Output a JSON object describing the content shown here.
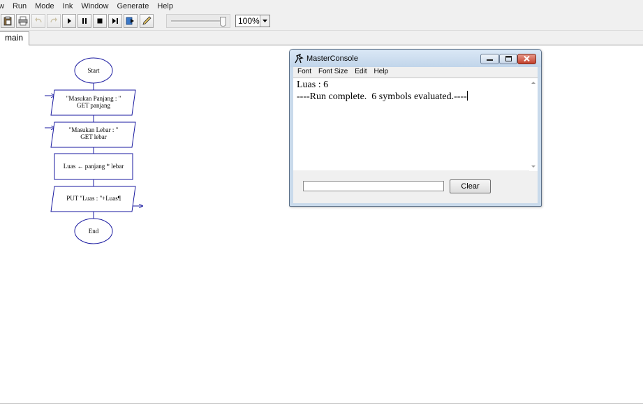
{
  "menubar": {
    "items": [
      {
        "label": "w"
      },
      {
        "label": "Run"
      },
      {
        "label": "Mode"
      },
      {
        "label": "Ink"
      },
      {
        "label": "Window"
      },
      {
        "label": "Generate"
      },
      {
        "label": "Help"
      }
    ]
  },
  "toolbar": {
    "zoom_value": "100%",
    "icons": [
      "paste-icon",
      "print-icon",
      "undo-icon",
      "redo-icon",
      "play-icon",
      "pause-icon",
      "stop-icon",
      "step-icon",
      "step-into-icon",
      "pen-icon"
    ]
  },
  "tabs": [
    {
      "label": "main"
    }
  ],
  "flowchart": {
    "start": "Start",
    "input1_line1": "\"Masukan Panjang : \"",
    "input1_line2": "GET panjang",
    "input2_line1": "\"Masukan Lebar : \"",
    "input2_line2": "GET lebar",
    "assign": "Luas ← panjang * lebar",
    "output": "PUT \"Luas : \"+Luas¶",
    "end": "End"
  },
  "console": {
    "title": "MasterConsole",
    "menu": [
      {
        "label": "Font"
      },
      {
        "label": "Font Size"
      },
      {
        "label": "Edit"
      },
      {
        "label": "Help"
      }
    ],
    "output_lines": [
      "Luas : 6",
      "----Run complete.  6 symbols evaluated.----"
    ],
    "input_value": "",
    "clear_label": "Clear"
  }
}
